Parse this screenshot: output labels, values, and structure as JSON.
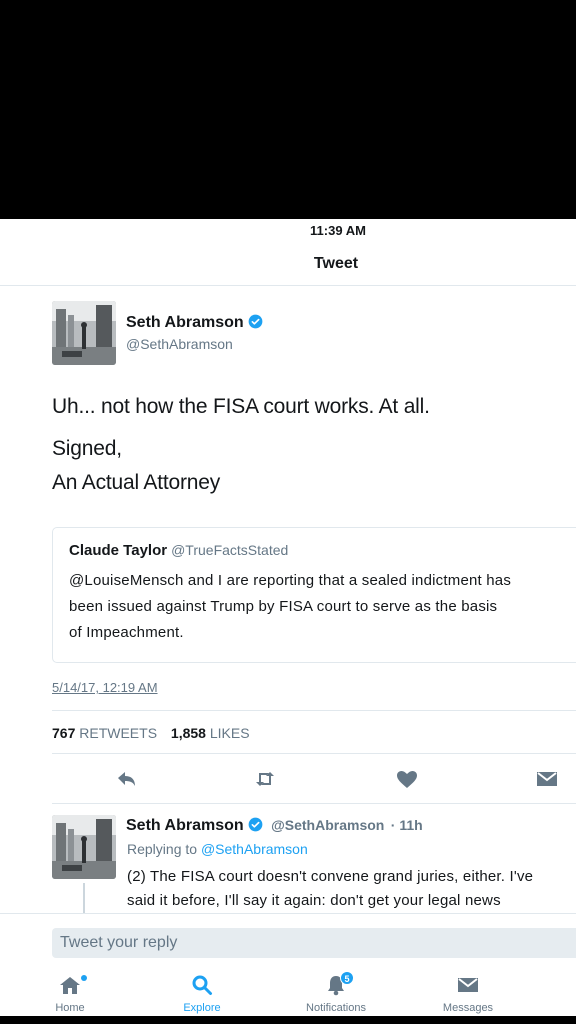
{
  "status": {
    "time": "11:39 AM"
  },
  "nav": {
    "title": "Tweet"
  },
  "tweet": {
    "name": "Seth Abramson",
    "handle": "@SethAbramson",
    "lines": [
      "Uh... not how the FISA court works. At all.",
      "Signed,",
      "An Actual Attorney"
    ],
    "timestamp": "5/14/17, 12:19 AM",
    "retweets": "767",
    "retweets_label": "RETWEETS",
    "likes": "1,858",
    "likes_label": "LIKES"
  },
  "quote": {
    "name": "Claude Taylor",
    "handle": "@TrueFactsStated",
    "lines": [
      "@LouiseMensch and I are reporting that a sealed indictment has",
      "been issued against Trump by FISA court to serve as the basis",
      "of Impeachment."
    ]
  },
  "reply": {
    "name": "Seth Abramson",
    "handle": "@SethAbramson",
    "time": "· 11h",
    "replying_prefix": "Replying to",
    "replying_to": "@SethAbramson",
    "lines": [
      "(2) The FISA court doesn't convene grand juries, either. I've",
      "said it before, I'll say it again: don't get your legal news"
    ]
  },
  "compose": {
    "placeholder": "Tweet your reply"
  },
  "tabs": [
    {
      "label": "Home",
      "icon": "home-icon"
    },
    {
      "label": "Explore",
      "icon": "search-icon"
    },
    {
      "label": "Notifications",
      "icon": "bell-icon",
      "badge": "5"
    },
    {
      "label": "Messages",
      "icon": "envelope-icon"
    }
  ],
  "colors": {
    "accent": "#1da1f2",
    "secondary_text": "#657786",
    "primary_text": "#14171a",
    "divider": "#e1e8ed"
  }
}
